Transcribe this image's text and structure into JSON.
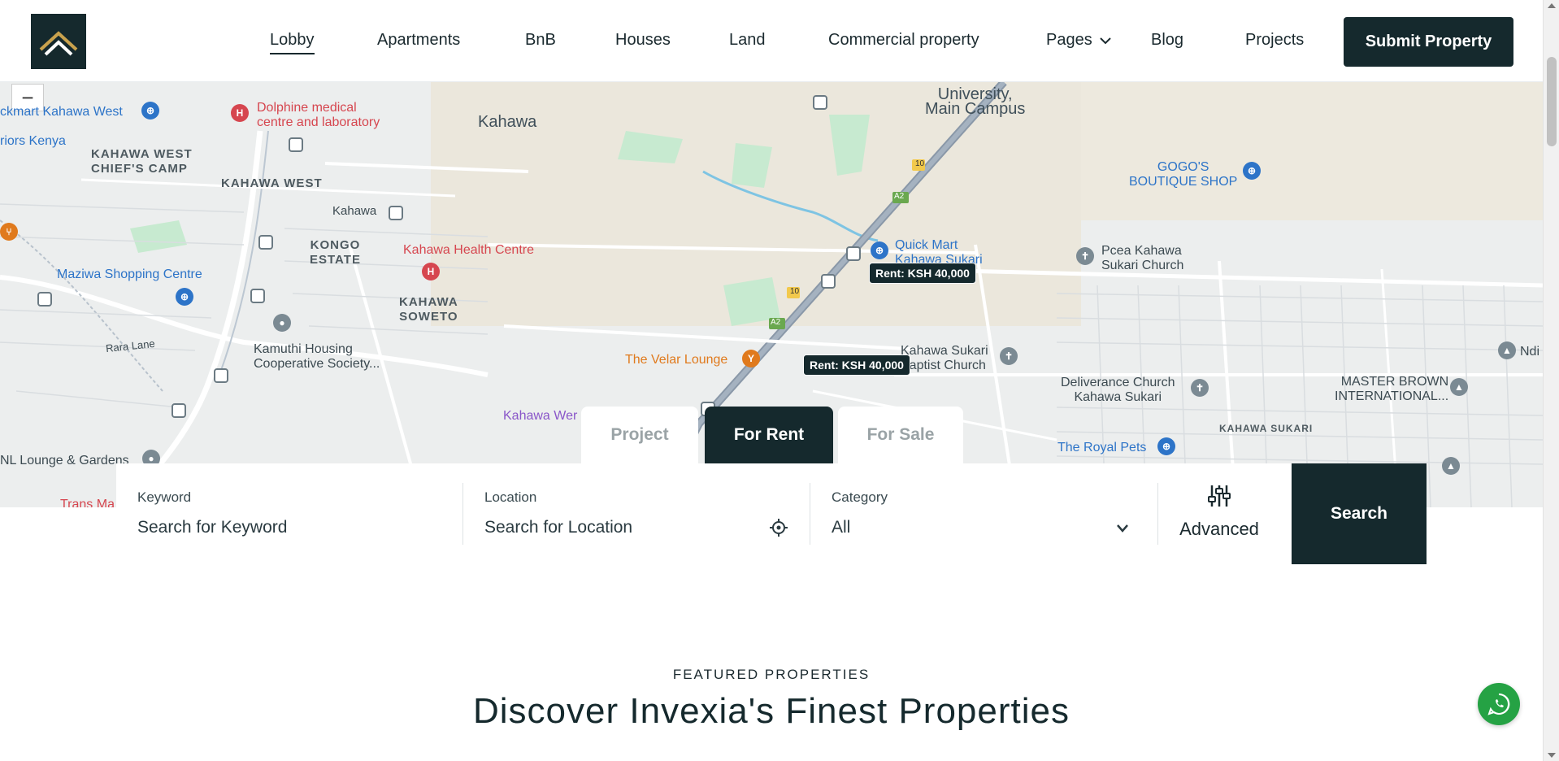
{
  "nav": {
    "items": [
      "Lobby",
      "Apartments",
      "BnB",
      "Houses",
      "Land",
      "Commercial property",
      "Pages",
      "Blog",
      "Projects"
    ],
    "active": "Lobby",
    "submit_label": "Submit Property"
  },
  "map": {
    "zoom_out_label": "−",
    "labels": {
      "place1": "ckmart Kahawa West",
      "place2": "riors Kenya",
      "dolphine": "Dolphine medical\ncentre and laboratory",
      "kahawa": "Kahawa",
      "university": "University,\nMain Campus",
      "kws_chiefs": "KAHAWA WEST\nCHIEF'S CAMP",
      "kahawa_west": "KAHAWA WEST",
      "kahawa_stop": "Kahawa",
      "kongo": "KONGO\nESTATE",
      "health": "Kahawa Health Centre",
      "soweto": "KAHAWA\nSOWETO",
      "maziwa": "Maziwa Shopping Centre",
      "kamuthi": "Kamuthi Housing\nCooperative Society...",
      "rara": "Rara Lane",
      "quickmart": "Quick Mart\nKahawa Sukari",
      "gogo": "GOGO'S\nBOUTIQUE SHOP",
      "pcea": "Pcea Kahawa\nSukari Church",
      "velar": "The Velar Lounge",
      "sukari_baptist": "Kahawa Sukari\nBaptist Church",
      "deliverance": "Deliverance Church\nKahawa Sukari",
      "master": "MASTER BROWN\nINTERNATIONAL...",
      "ndi": "Ndi",
      "kahawa_wendani": "Kahawa Wer",
      "royal": "The Royal Pets",
      "sukari": "KAHAWA SUKARI",
      "nl": "NL Lounge & Gardens",
      "trans": "Trans Ma",
      "route10a": "10",
      "route10b": "10",
      "routeA2a": "A2",
      "routeA2b": "A2"
    },
    "price_tags": [
      "Rent: KSH 40,000",
      "Rent: KSH 40,000"
    ]
  },
  "tabs": [
    "Project",
    "For Rent",
    "For Sale"
  ],
  "active_tab": "For Rent",
  "search": {
    "keyword_label": "Keyword",
    "keyword_placeholder": "Search for Keyword",
    "location_label": "Location",
    "location_placeholder": "Search for Location",
    "category_label": "Category",
    "category_value": "All",
    "advanced_label": "Advanced",
    "search_label": "Search"
  },
  "featured": {
    "kicker": "FEATURED PROPERTIES",
    "title": "Discover Invexia's Finest Properties"
  },
  "colors": {
    "brand_dark": "#15292d",
    "whatsapp": "#25a244"
  }
}
